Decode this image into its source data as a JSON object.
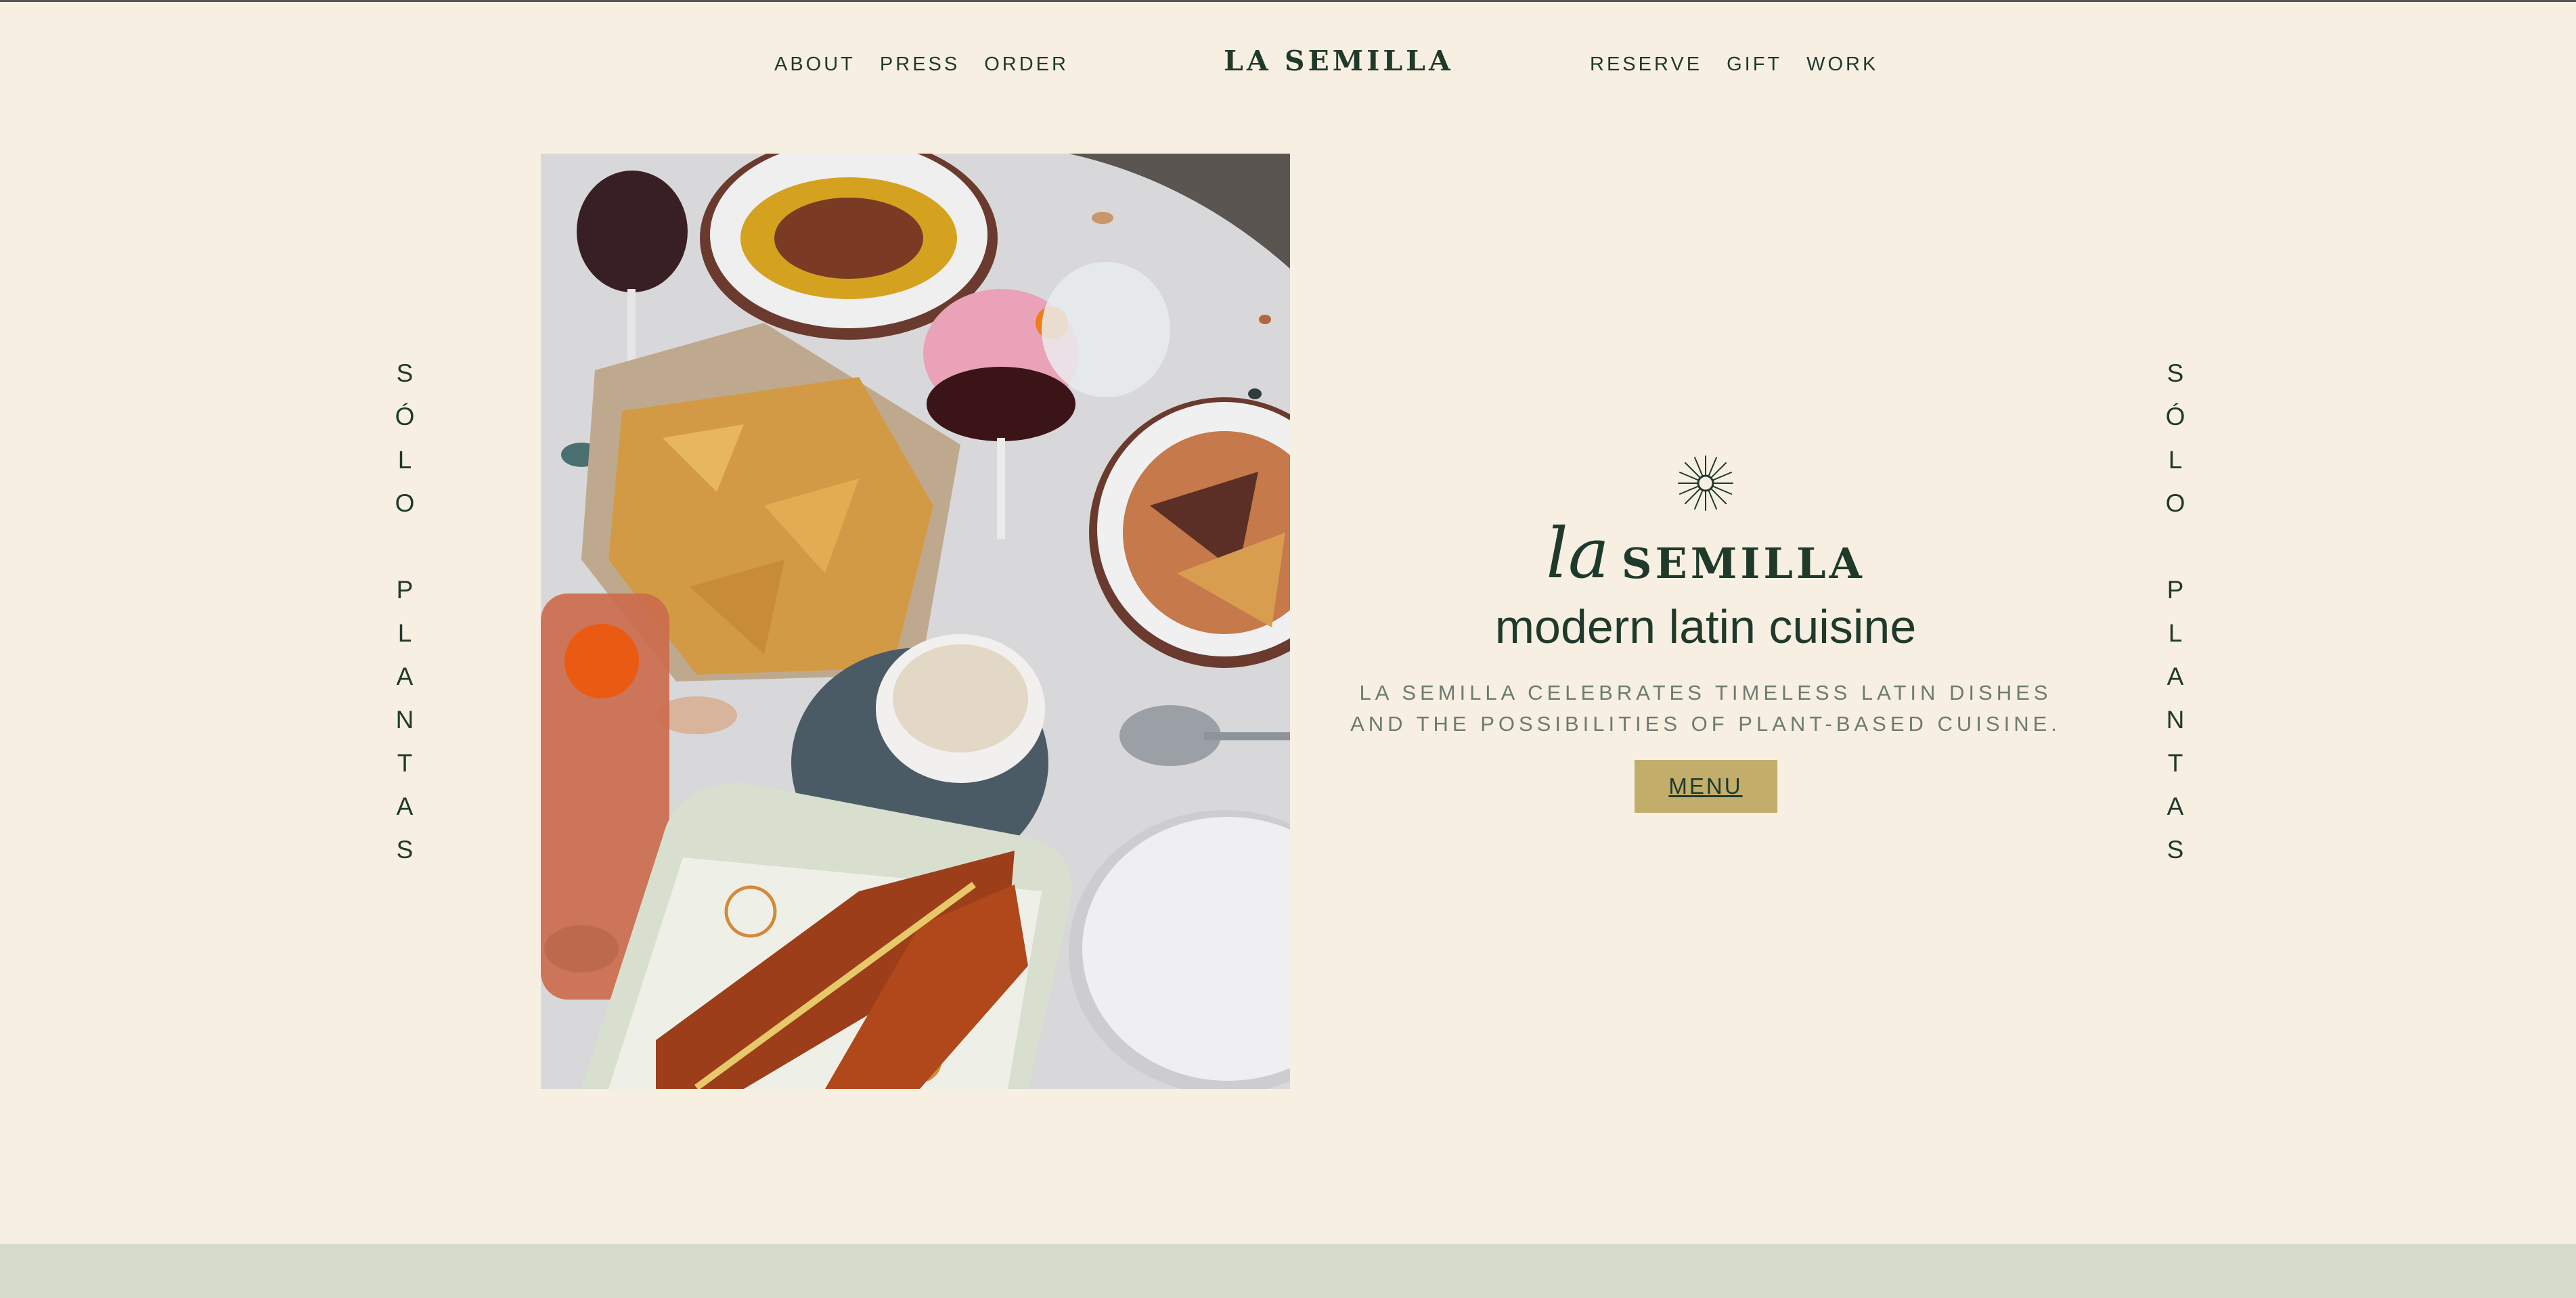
{
  "nav": {
    "left": [
      "ABOUT",
      "PRESS",
      "ORDER"
    ],
    "brand": "LA SEMILLA",
    "right": [
      "RESERVE",
      "GIFT",
      "WORK"
    ]
  },
  "side_text": {
    "left": [
      "S",
      "Ó",
      "L",
      "O",
      "",
      "P",
      "L",
      "A",
      "N",
      "T",
      "A",
      "S"
    ],
    "right": [
      "S",
      "Ó",
      "L",
      "O",
      "",
      "P",
      "L",
      "A",
      "N",
      "T",
      "A",
      "S"
    ]
  },
  "hero": {
    "logo_script": "la",
    "logo_word": "SEMILLA",
    "tagline": "modern latin cuisine",
    "description_line1": "LA SEMILLA CELEBRATES TIMELESS LATIN DISHES",
    "description_line2": "AND THE POSSIBILITIES OF PLANT-BASED CUISINE.",
    "menu_button": "MENU"
  },
  "icons": {
    "hero_mark": "sun-icon"
  },
  "colors": {
    "background": "#f7efe2",
    "text_green": "#1f3a2b",
    "button_gold": "#c2ad6b",
    "footer_band": "#d7dbc9"
  }
}
